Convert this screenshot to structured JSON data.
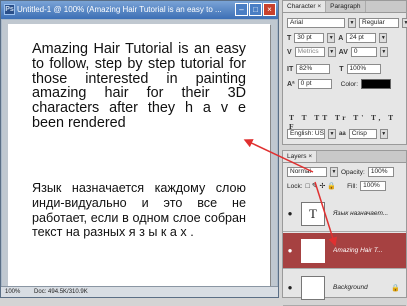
{
  "window": {
    "title": "Untitled-1 @ 100% (Amazing Hair Tutorial is an easy to ...",
    "ps_icon": "Ps"
  },
  "document": {
    "english_text": "Amazing Hair Tutorial is an easy to follow, step by step tutorial for those interested in painting amazing hair for their 3D characters after they h a v e been rendered",
    "russian_text": "Язык назначается каждому слою инди-видуально и это все не работает, если в одном слое собран текст на разных я з ы к а х ."
  },
  "statusbar": {
    "zoom": "100%",
    "doc": "Doc: 494.5K/310.9K"
  },
  "character_panel": {
    "tabs": [
      "Character ×",
      "Paragraph"
    ],
    "font_family": "Arial",
    "font_style": "Regular",
    "font_size": "30 pt",
    "leading": "24 pt",
    "kerning": "Metrics",
    "tracking": "0",
    "vertical_scale": "82%",
    "horizontal_scale": "100%",
    "baseline_shift": "0 pt",
    "color_label": "Color:",
    "type_styles": "T T TT Tr T' T, T F",
    "language": "English: USA",
    "antialias_label": "aa",
    "antialias": "Crisp"
  },
  "layers_panel": {
    "tab": "Layers ×",
    "blend_mode": "Normal",
    "opacity_label": "Opacity:",
    "opacity": "100%",
    "lock_label": "Lock:",
    "fill_label": "Fill:",
    "fill": "100%",
    "layers": [
      {
        "thumb": "T",
        "name": "Язык назначает...",
        "selected": false
      },
      {
        "thumb": "T",
        "name": "Amazing Hair T...",
        "selected": true
      },
      {
        "thumb": "",
        "name": "Background",
        "selected": false
      }
    ]
  },
  "colors": {
    "accent_arrow": "#e03030",
    "selected_layer": "#a64141",
    "titlebar": "#3c6fb5"
  }
}
